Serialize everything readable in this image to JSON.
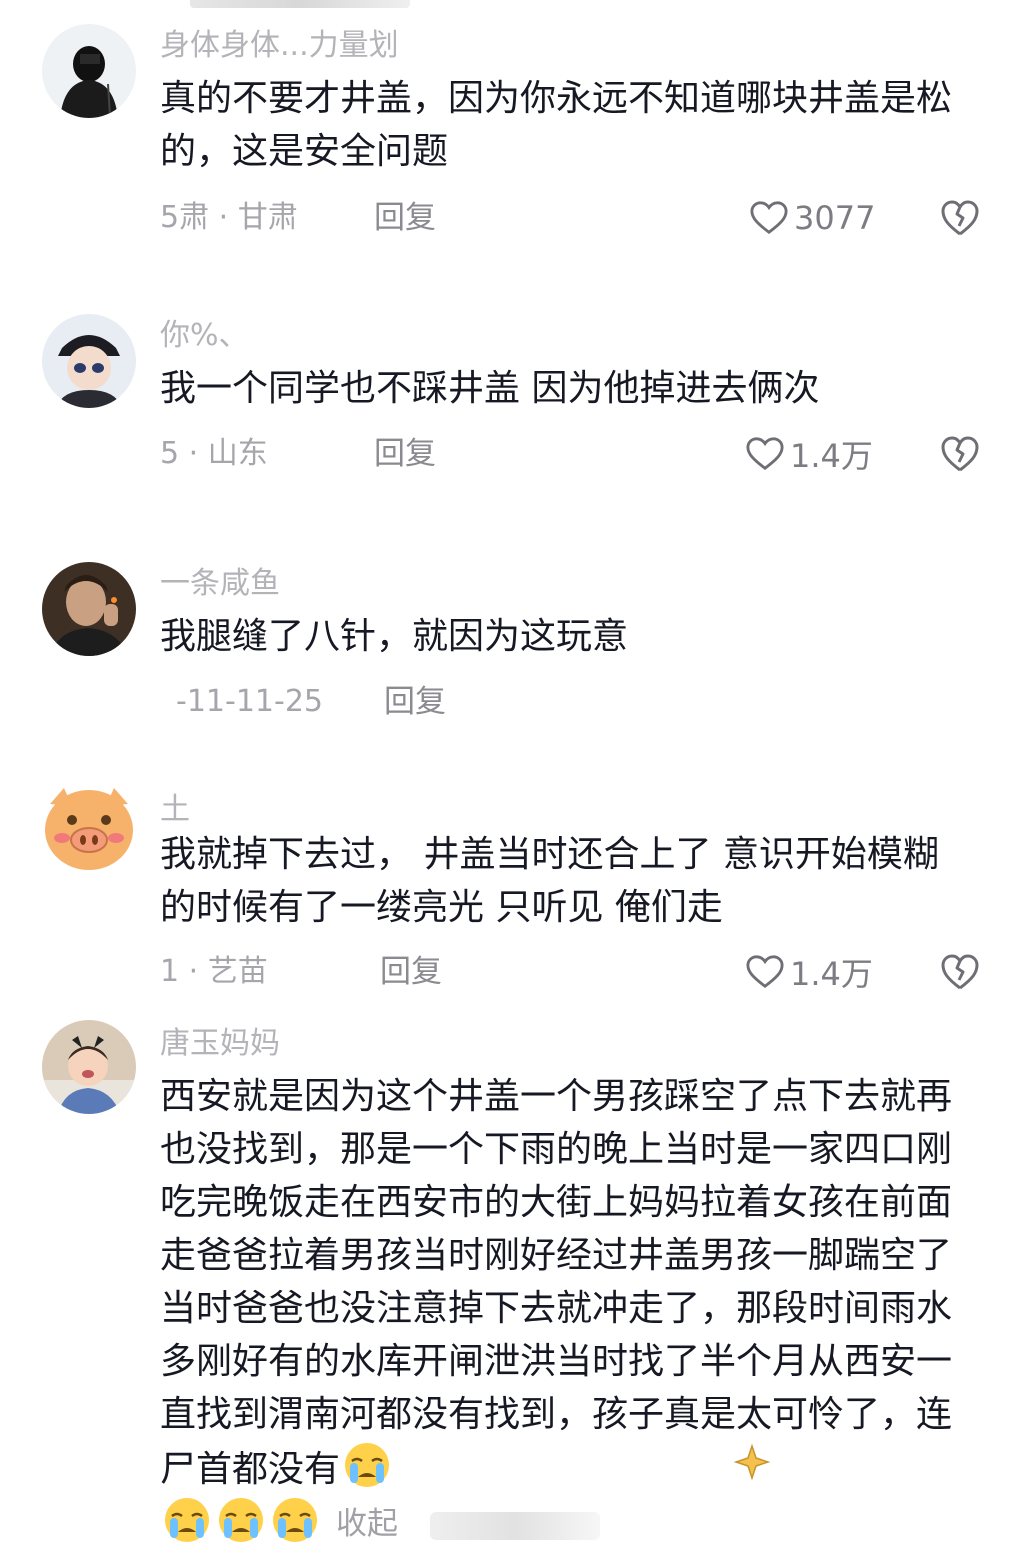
{
  "comments": [
    {
      "username": "身体身体...力量划",
      "text": "真的不要才井盖，因为你永远不知道哪块井盖是松的，这是安全问题",
      "meta": "5肃 · 甘肃",
      "reply": "回复",
      "likes": "3077"
    },
    {
      "username": "你%、",
      "text": "我一个同学也不踩井盖 因为他掉进去俩次",
      "meta": "5 · 山东",
      "reply": "回复",
      "likes": "1.4万"
    },
    {
      "username": "一条咸鱼",
      "text": "我腿缝了八针，就因为这玩意",
      "meta": "-11-11-25",
      "reply": "回复"
    },
    {
      "username": "土",
      "text": "我就掉下去过， 井盖当时还合上了 意识开始模糊的时候有了一缕亮光 只听见 俺们走",
      "meta": "1 · 艺苗",
      "reply": "回复",
      "likes": "1.4万"
    },
    {
      "username": "唐玉妈妈",
      "text": "西安就是因为这个井盖一个男孩踩空了点下去就再也没找到，那是一个下雨的晚上当时是一家四口刚吃完晚饭走在西安市的大街上妈妈拉着女孩在前面走爸爸拉着男孩当时刚好经过井盖男孩一脚踹空了当时爸爸也没注意掉下去就冲走了，那段时间雨水多刚好有的水库开闸泄洪当时找了半个月从西安一直找到渭南河都没有找到，孩子真是太可怜了，连尸首都没有",
      "collapse": "收起"
    }
  ],
  "icons": {
    "like": "heart-outline-icon",
    "dislike": "broken-heart-icon",
    "emoji": "crying-face-emoji"
  },
  "colors": {
    "text": "#161823",
    "meta": "#a5a5ab",
    "username": "#b3b3b8",
    "emoji": "#ffd04a"
  }
}
